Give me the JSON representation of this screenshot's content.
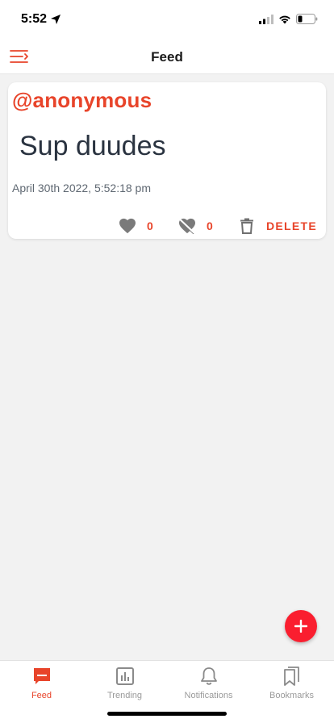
{
  "status_bar": {
    "time": "5:52"
  },
  "header": {
    "title": "Feed"
  },
  "post": {
    "author": "@anonymous",
    "body": "Sup duudes",
    "timestamp": "April 30th 2022, 5:52:18 pm",
    "likes": "0",
    "dislikes": "0",
    "delete_label": "DELETE"
  },
  "tabs": [
    {
      "label": "Feed",
      "icon": "feed-icon",
      "active": true
    },
    {
      "label": "Trending",
      "icon": "trending-icon",
      "active": false
    },
    {
      "label": "Notifications",
      "icon": "bell-icon",
      "active": false
    },
    {
      "label": "Bookmarks",
      "icon": "bookmarks-icon",
      "active": false
    }
  ],
  "colors": {
    "accent": "#e8442a",
    "fab": "#fa1e2f",
    "background": "#f2f2f2"
  }
}
